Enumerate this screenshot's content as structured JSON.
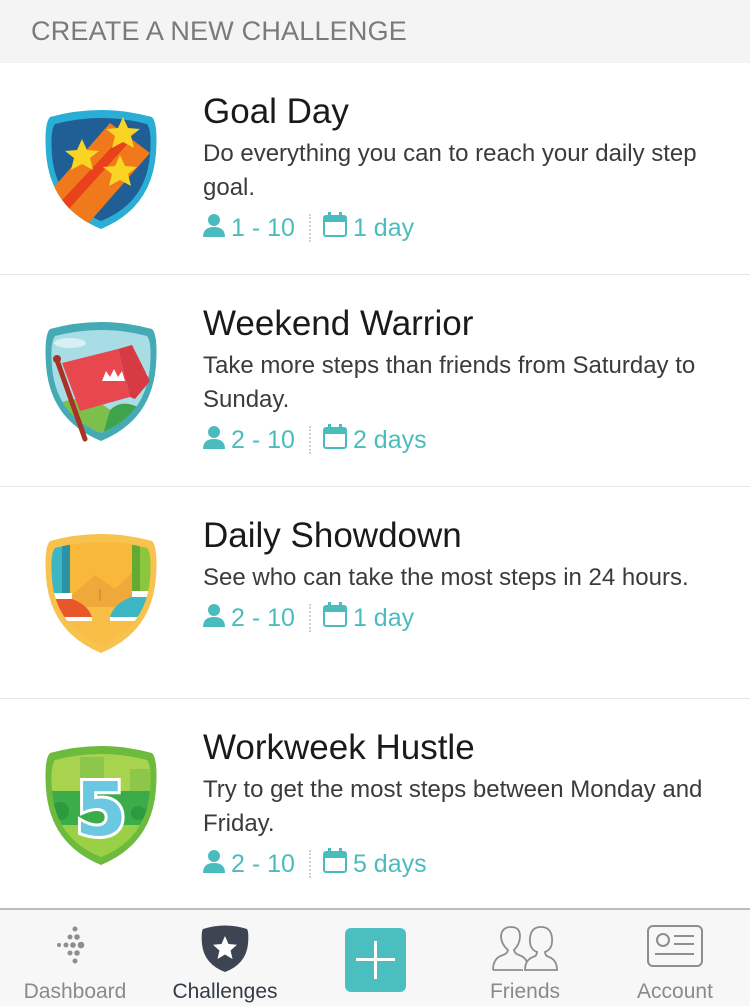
{
  "header": {
    "title": "CREATE A NEW CHALLENGE"
  },
  "challenges": [
    {
      "title": "Goal Day",
      "description": "Do everything you can to reach your daily step goal.",
      "participants": "1 - 10",
      "duration": "1 day",
      "badge_icon": "shooting-stars-badge-icon"
    },
    {
      "title": "Weekend Warrior",
      "description": "Take more steps than friends from Saturday to Sunday.",
      "participants": "2 - 10",
      "duration": "2 days",
      "badge_icon": "flag-crown-badge-icon"
    },
    {
      "title": "Daily Showdown",
      "description": "See who can take the most steps in 24 hours.",
      "participants": "2 - 10",
      "duration": "1 day",
      "badge_icon": "sneakers-desert-badge-icon"
    },
    {
      "title": "Workweek Hustle",
      "description": "Try to get the most steps between Monday and Friday.",
      "participants": "2 - 10",
      "duration": "5 days",
      "badge_icon": "number-five-park-badge-icon"
    }
  ],
  "tabbar": {
    "tabs": [
      {
        "label": "Dashboard",
        "icon": "dashboard-dots-icon",
        "active": false
      },
      {
        "label": "Challenges",
        "icon": "challenges-shield-star-icon",
        "active": true
      },
      {
        "label": "",
        "icon": "add-plus-icon",
        "active": false
      },
      {
        "label": "Friends",
        "icon": "friends-icon",
        "active": false
      },
      {
        "label": "Account",
        "icon": "account-card-icon",
        "active": false
      }
    ]
  },
  "colors": {
    "accent": "#4bbfbf",
    "header_bg": "#f4f4f4",
    "active_tab": "#333b45",
    "inactive_tab": "#8a8a8a"
  }
}
